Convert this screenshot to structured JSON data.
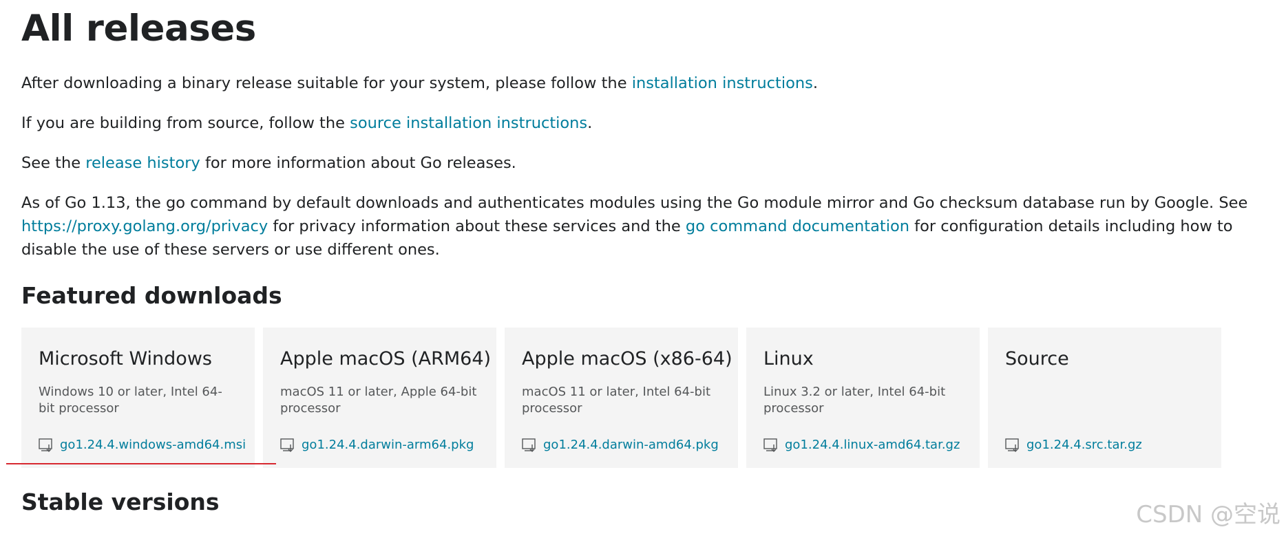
{
  "header": {
    "title": "All releases"
  },
  "intro": {
    "p1_before": "After downloading a binary release suitable for your system, please follow the ",
    "p1_link": "installation instructions",
    "p1_after": ".",
    "p2_before": "If you are building from source, follow the ",
    "p2_link": "source installation instructions",
    "p2_after": ".",
    "p3_before": "See the ",
    "p3_link": "release history",
    "p3_after": " for more information about Go releases.",
    "p4_before": "As of Go 1.13, the go command by default downloads and authenticates modules using the Go module mirror and Go checksum database run by Google. See ",
    "p4_link1": "https://proxy.golang.org/privacy",
    "p4_mid": " for privacy information about these services and the ",
    "p4_link2": "go command documentation",
    "p4_after": " for configuration details including how to disable the use of these servers or use different ones."
  },
  "featured": {
    "heading": "Featured downloads",
    "cards": [
      {
        "title": "Microsoft Windows",
        "desc": "Windows 10 or later, Intel 64-bit processor",
        "file": "go1.24.4.windows-amd64.msi",
        "icon": "download-icon"
      },
      {
        "title": "Apple macOS (ARM64)",
        "desc": "macOS 11 or later, Apple 64-bit processor",
        "file": "go1.24.4.darwin-arm64.pkg",
        "icon": "download-icon"
      },
      {
        "title": "Apple macOS (x86-64)",
        "desc": "macOS 11 or later, Intel 64-bit processor",
        "file": "go1.24.4.darwin-amd64.pkg",
        "icon": "download-icon"
      },
      {
        "title": "Linux",
        "desc": "Linux 3.2 or later, Intel 64-bit processor",
        "file": "go1.24.4.linux-amd64.tar.gz",
        "icon": "download-icon"
      },
      {
        "title": "Source",
        "desc": "",
        "file": "go1.24.4.src.tar.gz",
        "icon": "download-icon"
      }
    ]
  },
  "stable": {
    "heading": "Stable versions"
  },
  "watermark": {
    "text": "CSDN @空说"
  },
  "colors": {
    "link": "#007d9c",
    "text": "#202224",
    "card_bg": "#f4f4f4",
    "annotation": "#d7282f"
  }
}
